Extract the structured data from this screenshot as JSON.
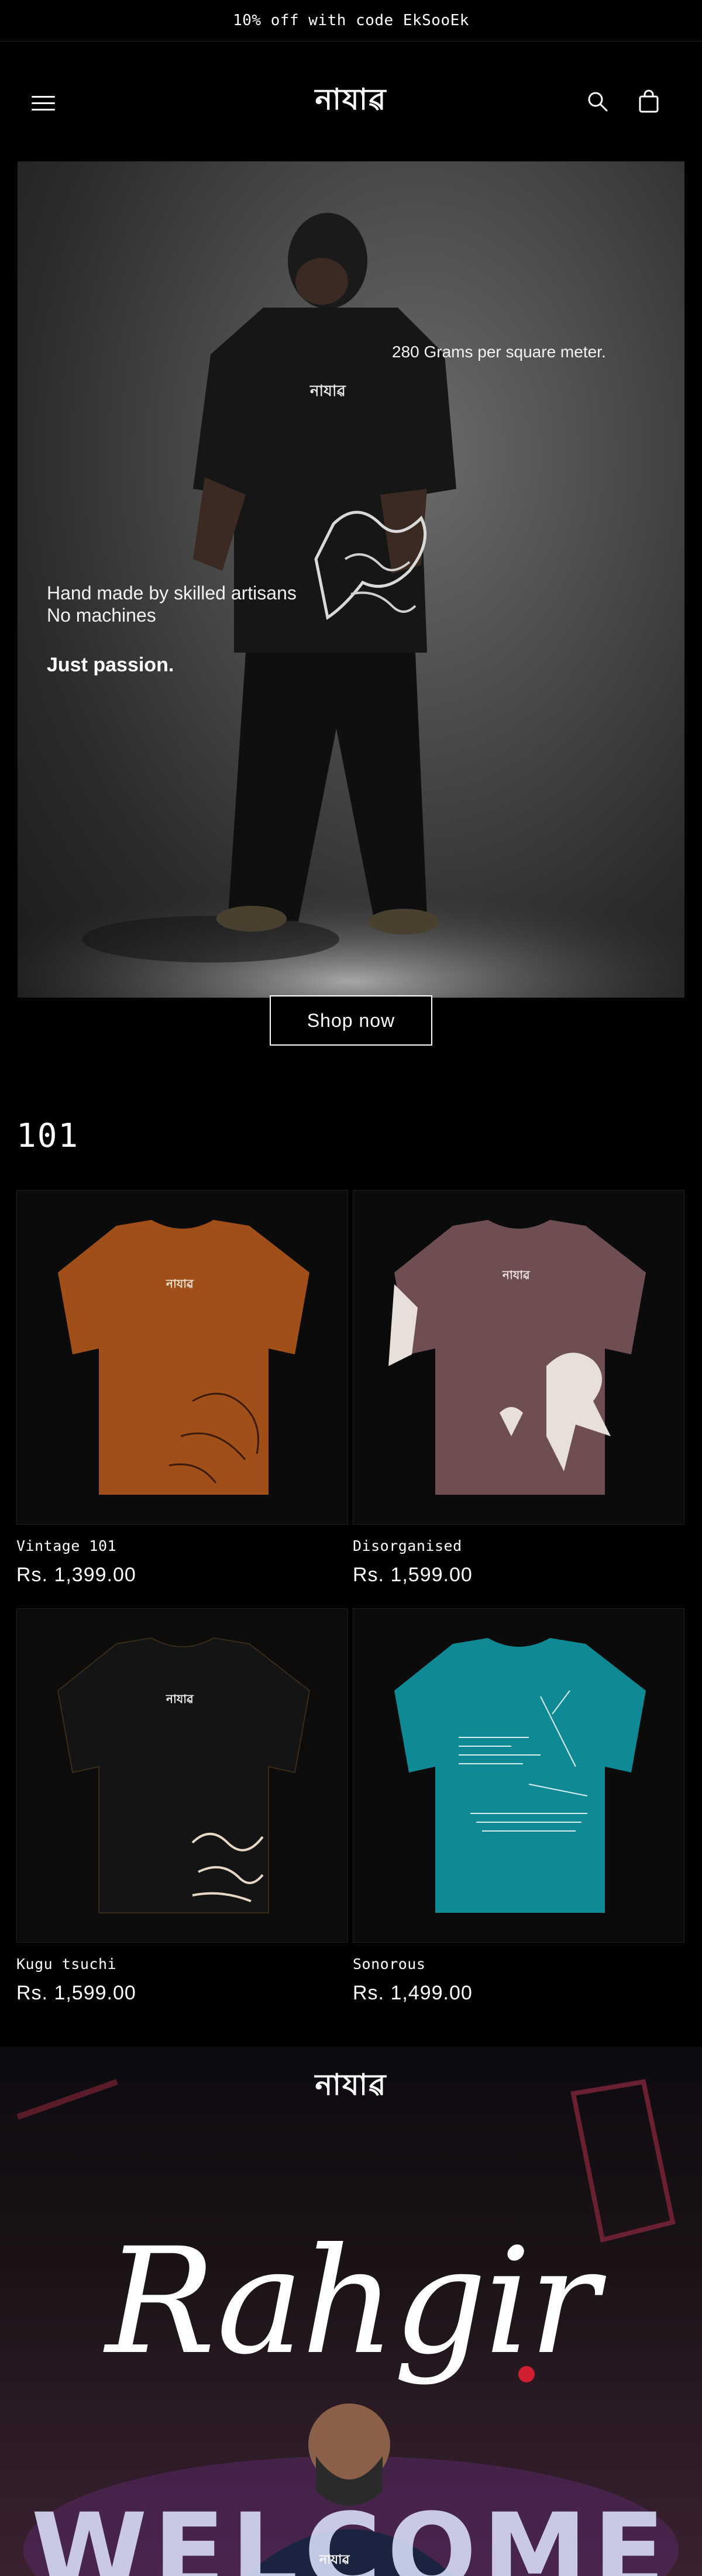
{
  "announcement": {
    "text": "10% off with code EkSooEk"
  },
  "header": {
    "logo": "নাযাৱ",
    "menu_icon": "hamburger-menu-icon",
    "search_icon": "search-icon",
    "cart_icon": "shopping-bag-icon"
  },
  "hero": {
    "shirt_logo": "নাযাৱ",
    "caption_top": "280 Grams per square meter.",
    "caption_line1": "Hand made by skilled artisans",
    "caption_line2": "No machines",
    "caption_bold": "Just passion.",
    "button_label": "Shop now"
  },
  "collection": {
    "title": "101",
    "products": [
      {
        "name": "Vintage 101",
        "price": "Rs. 1,399.00",
        "color": "#a04f18",
        "shirt_logo": "নাযাৱ"
      },
      {
        "name": "Disorganised",
        "price": "Rs. 1,599.00",
        "color": "#6f4e52",
        "shirt_logo": "নাযাৱ"
      },
      {
        "name": "Kugu tsuchi",
        "price": "Rs. 1,599.00",
        "color": "#141414",
        "shirt_logo": "নাযাৱ"
      },
      {
        "name": "Sonorous",
        "price": "Rs. 1,499.00",
        "color": "#0f8a94",
        "shirt_logo": ""
      }
    ]
  },
  "promo": {
    "logo": "নাযাৱ",
    "script_title": "Rahgir",
    "bg_text": "WELCOME",
    "shirt_logo": "নাযাৱ"
  }
}
